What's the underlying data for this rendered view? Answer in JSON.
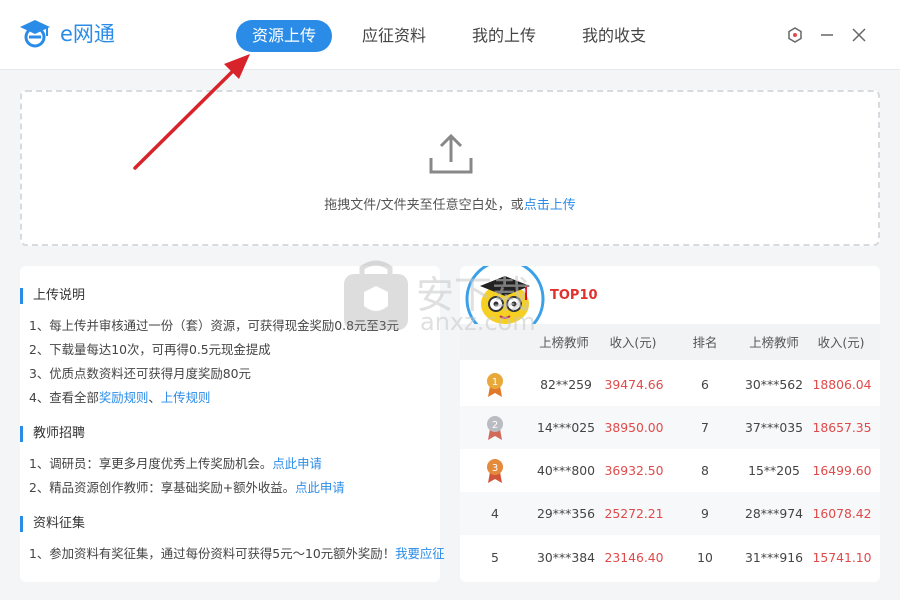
{
  "app": {
    "name": "e网通"
  },
  "tabs": [
    {
      "label": "资源上传",
      "active": true
    },
    {
      "label": "应征资料",
      "active": false
    },
    {
      "label": "我的上传",
      "active": false
    },
    {
      "label": "我的收支",
      "active": false
    }
  ],
  "window_controls": [
    "settings-hex-icon",
    "minimize-icon",
    "close-icon"
  ],
  "upload": {
    "hint_prefix": "拖拽文件/文件夹至任意空白处，或",
    "hint_link": "点击上传"
  },
  "sections": {
    "upload_notes": {
      "title": "上传说明",
      "lines": [
        "1、每上传并审核通过一份（套）资源，可获得现金奖励0.8元至3元",
        "2、下载量每达10次，可再得0.5元现金提成",
        "3、优质点数资料还可获得月度奖励80元"
      ],
      "line4_prefix": "4、查看全部",
      "line4_link1": "奖励规则",
      "line4_sep": "、",
      "line4_link2": "上传规则"
    },
    "recruit": {
      "title": "教师招聘",
      "line1_text": "1、调研员：享更多月度优秀上传奖励机会。",
      "line1_link": "点此申请",
      "line2_text": "2、精品资源创作教师：享基础奖励+额外收益。",
      "line2_link": "点此申请"
    },
    "collect": {
      "title": "资料征集",
      "line1_text": "1、参加资料有奖征集，通过每份资料可获得5元～10元额外奖励！",
      "line1_link": "我要应征"
    }
  },
  "ranking": {
    "title": "TOP10",
    "headers": {
      "teacher": "上榜教师",
      "income": "收入(元)",
      "rank": "排名"
    },
    "left": [
      {
        "rank": "1",
        "teacher": "82**259",
        "income": "39474.66"
      },
      {
        "rank": "2",
        "teacher": "14***025",
        "income": "38950.00"
      },
      {
        "rank": "3",
        "teacher": "40***800",
        "income": "36932.50"
      },
      {
        "rank": "4",
        "teacher": "29***356",
        "income": "25272.21"
      },
      {
        "rank": "5",
        "teacher": "30***384",
        "income": "23146.40"
      }
    ],
    "right": [
      {
        "rank": "6",
        "teacher": "30***562",
        "income": "18806.04"
      },
      {
        "rank": "7",
        "teacher": "37***035",
        "income": "18657.35"
      },
      {
        "rank": "8",
        "teacher": "15**205",
        "income": "16499.60"
      },
      {
        "rank": "9",
        "teacher": "28***974",
        "income": "16078.42"
      },
      {
        "rank": "10",
        "teacher": "31***916",
        "income": "15741.10"
      }
    ],
    "medal_colors": [
      "#e8a93a",
      "#b9bcc2",
      "#e48a3c"
    ]
  },
  "watermark": {
    "text": "安下载",
    "sub": "anxz.com"
  },
  "colors": {
    "accent": "#2b8ce8",
    "money": "#e04a4a",
    "arrow": "#d8232a"
  }
}
